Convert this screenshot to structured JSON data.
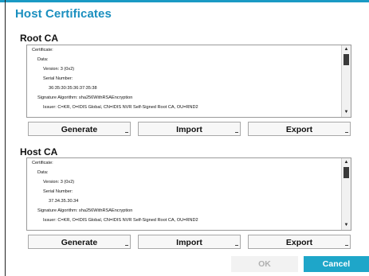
{
  "dialog": {
    "title": "Host Certificates",
    "accent_color": "#1a8fbf",
    "ok_label": "OK",
    "cancel_label": "Cancel"
  },
  "root_ca": {
    "label": "Root CA",
    "lines": [
      "Certificate:",
      "Data:",
      "Version: 3 (0x2)",
      "Serial Number:",
      "36:35:30:35:36:37:35:38",
      "Signature Algorithm: sha256WithRSAEncryption",
      "Issuer: C=KR, O=IDIS Global, CN=IDIS NVR Self-Signed Root CA, OU=RND2"
    ],
    "buttons": {
      "generate": "Generate",
      "import": "Import",
      "export": "Export"
    }
  },
  "host_ca": {
    "label": "Host CA",
    "lines": [
      "Certificate:",
      "Data:",
      "Version: 3 (0x2)",
      "Serial Number:",
      "37.34.35.30.34",
      "Signature Algorithm: sha256WithRSAEncryption",
      "Issuer: C=KR, O=IDIS Global, CN=IDIS NVR Self-Signed Root CA, OU=RND2"
    ],
    "buttons": {
      "generate": "Generate",
      "import": "Import",
      "export": "Export"
    }
  }
}
